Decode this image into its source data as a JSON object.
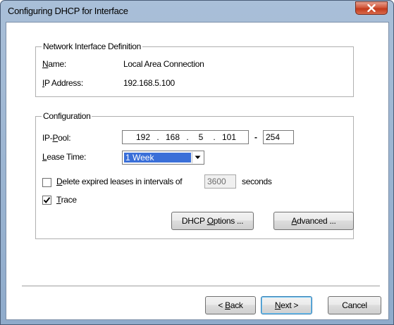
{
  "window": {
    "title": "Configuring DHCP for Interface"
  },
  "interface_group": {
    "title": "Network Interface Definition",
    "name_label": "Name:",
    "name_value": "Local Area Connection",
    "ip_label": "IP Address:",
    "ip_value": "192.168.5.100"
  },
  "config_group": {
    "title": "Configuration",
    "ip_pool_label": "IP-Pool:",
    "ip_pool_start": [
      "192",
      "168",
      "5",
      "101"
    ],
    "ip_pool_dash": "-",
    "ip_pool_end": "254",
    "lease_time_label": "Lease Time:",
    "lease_time_value": "1 Week",
    "delete_expired_label": "Delete expired leases in intervals of",
    "delete_expired_checked": false,
    "interval_value": "3600",
    "interval_unit": "seconds",
    "trace_label": "Trace",
    "trace_checked": true,
    "dhcp_options_button": "DHCP Options ...",
    "advanced_button": "Advanced ..."
  },
  "footer": {
    "back_button": "< Back",
    "next_button": "Next >",
    "cancel_button": "Cancel"
  },
  "icons": {
    "close": "close-icon",
    "dropdown": "chevron-down-icon",
    "checkmark": "checkmark-icon"
  }
}
